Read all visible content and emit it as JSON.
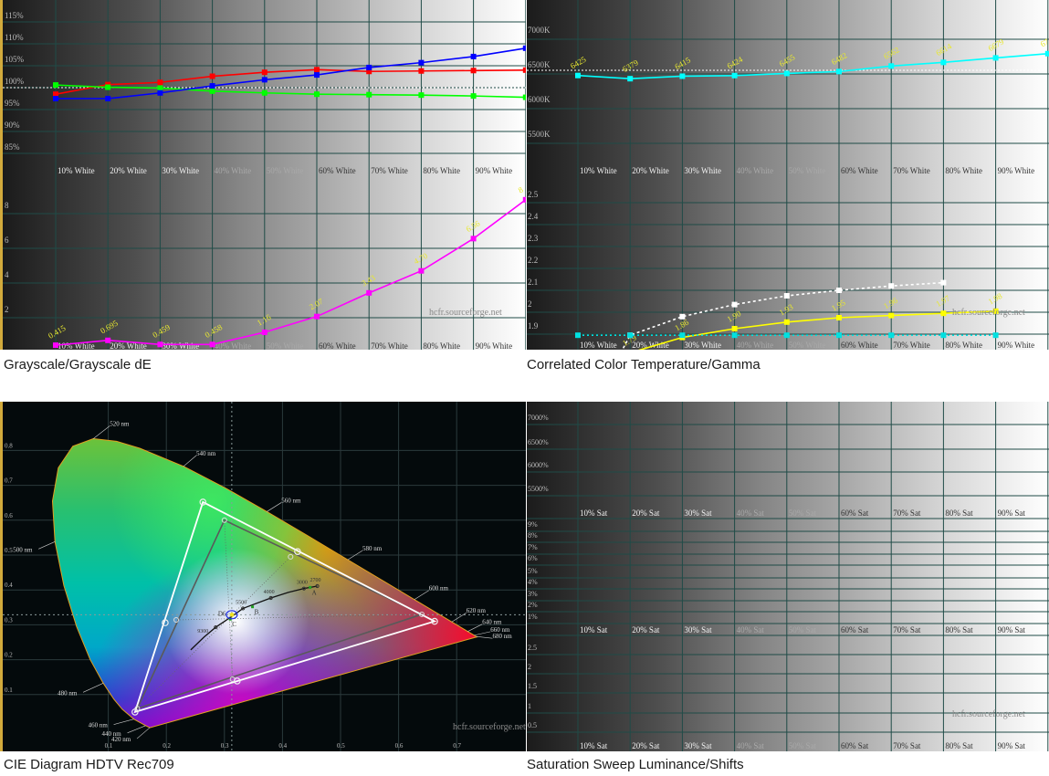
{
  "captions": {
    "grayscale": "Grayscale/Grayscale dE",
    "cct_gamma": "Correlated Color Temperature/Gamma",
    "cie": "CIE Diagram HDTV Rec709",
    "saturation": "Saturation Sweep Luminance/Shifts"
  },
  "watermark": "hcfr.sourceforge.net",
  "chart_data": [
    {
      "id": "grayscale-rgb",
      "type": "line",
      "categories": [
        "10% White",
        "20% White",
        "30% White",
        "40% White",
        "50% White",
        "60% White",
        "70% White",
        "80% White",
        "90% White"
      ],
      "x": [
        10,
        20,
        30,
        40,
        50,
        60,
        70,
        80,
        90,
        100
      ],
      "yticks": [
        "115%",
        "110%",
        "105%",
        "100%",
        "95%",
        "90%",
        "85%"
      ],
      "ytick_values": [
        115,
        110,
        105,
        100,
        95,
        90,
        85
      ],
      "reference": 100,
      "grid": true,
      "series": [
        {
          "color": "#ff0000",
          "values": [
            98.5,
            100.7,
            101.2,
            102.6,
            103.5,
            104.1,
            103.7,
            103.8,
            103.9,
            104.0
          ]
        },
        {
          "color": "#00ff00",
          "values": [
            100.6,
            100.1,
            99.9,
            99.2,
            98.8,
            98.5,
            98.4,
            98.3,
            98.1,
            97.8
          ]
        },
        {
          "color": "#0000ff",
          "values": [
            97.5,
            97.5,
            98.8,
            100.4,
            101.8,
            102.9,
            104.6,
            105.7,
            107.1,
            109.0
          ]
        }
      ]
    },
    {
      "id": "grayscale-de",
      "type": "line",
      "categories": [
        "10% White",
        "20% White",
        "30% White",
        "40% White",
        "50% White",
        "60% White",
        "70% White",
        "80% White",
        "90% White"
      ],
      "x": [
        10,
        20,
        30,
        40,
        50,
        60,
        70,
        80,
        90,
        100
      ],
      "yticks": [
        "8",
        "6",
        "4",
        "2"
      ],
      "ytick_values": [
        8,
        6,
        4,
        2
      ],
      "grid": true,
      "series": [
        {
          "color": "#ff00ff",
          "values": [
            0.415,
            0.695,
            0.459,
            0.458,
            1.16,
            2.07,
            3.43,
            4.7,
            6.56,
            8.8
          ],
          "labels": [
            "0.415",
            "0.695",
            "0.459",
            "0.458",
            "1.16",
            "2.07",
            "3.43",
            "4.70",
            "6.56",
            "8"
          ]
        }
      ]
    },
    {
      "id": "cct",
      "type": "line",
      "categories": [
        "10% White",
        "20% White",
        "30% White",
        "40% White",
        "50% White",
        "60% White",
        "70% White",
        "80% White",
        "90% White"
      ],
      "x": [
        10,
        20,
        30,
        40,
        50,
        60,
        70,
        80,
        90,
        100
      ],
      "yticks": [
        "7000K",
        "6500K",
        "6000K",
        "5500K"
      ],
      "ytick_values": [
        7000,
        6500,
        6000,
        5500
      ],
      "reference": 6500,
      "grid": true,
      "series": [
        {
          "color": "#00ffff",
          "values": [
            6425,
            6379,
            6415,
            6424,
            6455,
            6482,
            6562,
            6614,
            6679,
            6740
          ],
          "labels": [
            "6425",
            "6379",
            "6415",
            "6424",
            "6455",
            "6482",
            "6562",
            "6614",
            "6679",
            "67"
          ]
        }
      ]
    },
    {
      "id": "gamma",
      "type": "line",
      "categories": [
        "10% White",
        "20% White",
        "30% White",
        "40% White",
        "50% White",
        "60% White",
        "70% White",
        "80% White",
        "90% White"
      ],
      "yticks": [
        "2.5",
        "2.4",
        "2.3",
        "2.2",
        "2.1",
        "2",
        "1.9"
      ],
      "ytick_values": [
        2.5,
        2.4,
        2.3,
        2.2,
        2.1,
        2.0,
        1.9
      ],
      "grid": true,
      "series": [
        {
          "color": "#ffff00",
          "x": [
            20,
            30,
            40,
            50,
            60,
            70,
            80,
            90
          ],
          "values": [
            1.79,
            1.86,
            1.9,
            1.93,
            1.95,
            1.96,
            1.97,
            1.98
          ],
          "labels": [
            "1.79",
            "1.86",
            "1.90",
            "1.93",
            "1.95",
            "1.96",
            "1.97",
            "1.98"
          ]
        },
        {
          "color": "#ffffff",
          "style": "dashed",
          "x": [
            20,
            30,
            40,
            50,
            60,
            70,
            80
          ],
          "values": [
            1.87,
            1.955,
            2.01,
            2.05,
            2.075,
            2.095,
            2.11
          ]
        },
        {
          "color": "#00e0e0",
          "style": "dotted",
          "x": [
            10,
            20,
            30,
            40,
            50,
            60,
            70,
            80,
            90
          ],
          "values": [
            1.87,
            1.87,
            1.87,
            1.87,
            1.87,
            1.87,
            1.87,
            1.87,
            1.87
          ]
        }
      ]
    },
    {
      "id": "cie",
      "type": "scatter",
      "xticks": [
        "0.1",
        "0.2",
        "0.3",
        "0.4",
        "0.5",
        "0.6",
        "0.7"
      ],
      "xtick_values": [
        0.1,
        0.2,
        0.3,
        0.4,
        0.5,
        0.6,
        0.7
      ],
      "yticks": [
        "0.8",
        "0.7",
        "0.6",
        "0.5",
        "0.4",
        "0.3",
        "0.2",
        "0.1"
      ],
      "ytick_values": [
        0.8,
        0.7,
        0.6,
        0.5,
        0.4,
        0.3,
        0.2,
        0.1
      ],
      "grid": true,
      "reference_gamut": {
        "red": [
          0.64,
          0.33
        ],
        "green": [
          0.3,
          0.6
        ],
        "blue": [
          0.15,
          0.06
        ],
        "yellow": [
          0.414,
          0.495
        ],
        "cyan": [
          0.217,
          0.314
        ],
        "magenta": [
          0.314,
          0.144
        ]
      },
      "measured_gamut": {
        "red": [
          0.662,
          0.31
        ],
        "green": [
          0.263,
          0.652
        ],
        "blue": [
          0.146,
          0.05
        ],
        "yellow": [
          0.426,
          0.51
        ],
        "cyan": [
          0.198,
          0.306
        ],
        "magenta": [
          0.322,
          0.139
        ]
      },
      "white_target": [
        0.3127,
        0.329
      ],
      "white_measured": [
        0.313,
        0.329
      ],
      "wavelengths": [
        {
          "label": "520 nm",
          "nm": 520
        },
        {
          "label": "540 nm",
          "nm": 540
        },
        {
          "label": "560 nm",
          "nm": 560
        },
        {
          "label": "580 nm",
          "nm": 580
        },
        {
          "label": "600 nm",
          "nm": 600
        },
        {
          "label": "620 nm",
          "nm": 620
        },
        {
          "label": "640 nm",
          "nm": 640
        },
        {
          "label": "660 nm",
          "nm": 660
        },
        {
          "label": "680 nm",
          "nm": 680
        },
        {
          "label": "500 nm",
          "nm": 500
        },
        {
          "label": "480 nm",
          "nm": 480
        },
        {
          "label": "460 nm",
          "nm": 460
        },
        {
          "label": "440 nm",
          "nm": 440
        },
        {
          "label": "420 nm",
          "nm": 420
        }
      ],
      "planckian_labels": [
        {
          "label": "9300",
          "xy": [
            0.285,
            0.293
          ]
        },
        {
          "label": "5500",
          "xy": [
            0.332,
            0.347
          ]
        },
        {
          "label": "4000",
          "xy": [
            0.38,
            0.377
          ]
        },
        {
          "label": "3000",
          "xy": [
            0.437,
            0.404
          ]
        },
        {
          "label": "2700",
          "xy": [
            0.46,
            0.411
          ]
        }
      ],
      "illuminants": [
        {
          "label": "A",
          "xy": [
            0.4476,
            0.4074
          ]
        },
        {
          "label": "B",
          "xy": [
            0.3484,
            0.3516
          ]
        },
        {
          "label": "C",
          "xy": [
            0.3101,
            0.3162
          ]
        },
        {
          "label": "D6",
          "xy": [
            0.3127,
            0.329
          ]
        }
      ]
    },
    {
      "id": "saturation",
      "type": "line",
      "categories": [
        "10% Sat",
        "20% Sat",
        "30% Sat",
        "40% Sat",
        "50% Sat",
        "60% Sat",
        "70% Sat",
        "80% Sat",
        "90% Sat"
      ],
      "luminance_yticks": [
        "7000%",
        "6500%",
        "6000%",
        "5500%"
      ],
      "shift_yticks": [
        "9%",
        "8%",
        "7%",
        "6%",
        "5%",
        "4%",
        "3%",
        "2%",
        "1%"
      ],
      "de_yticks": [
        "2.5",
        "2",
        "1.5",
        "1",
        "0.5"
      ],
      "grid": true,
      "series": []
    }
  ]
}
